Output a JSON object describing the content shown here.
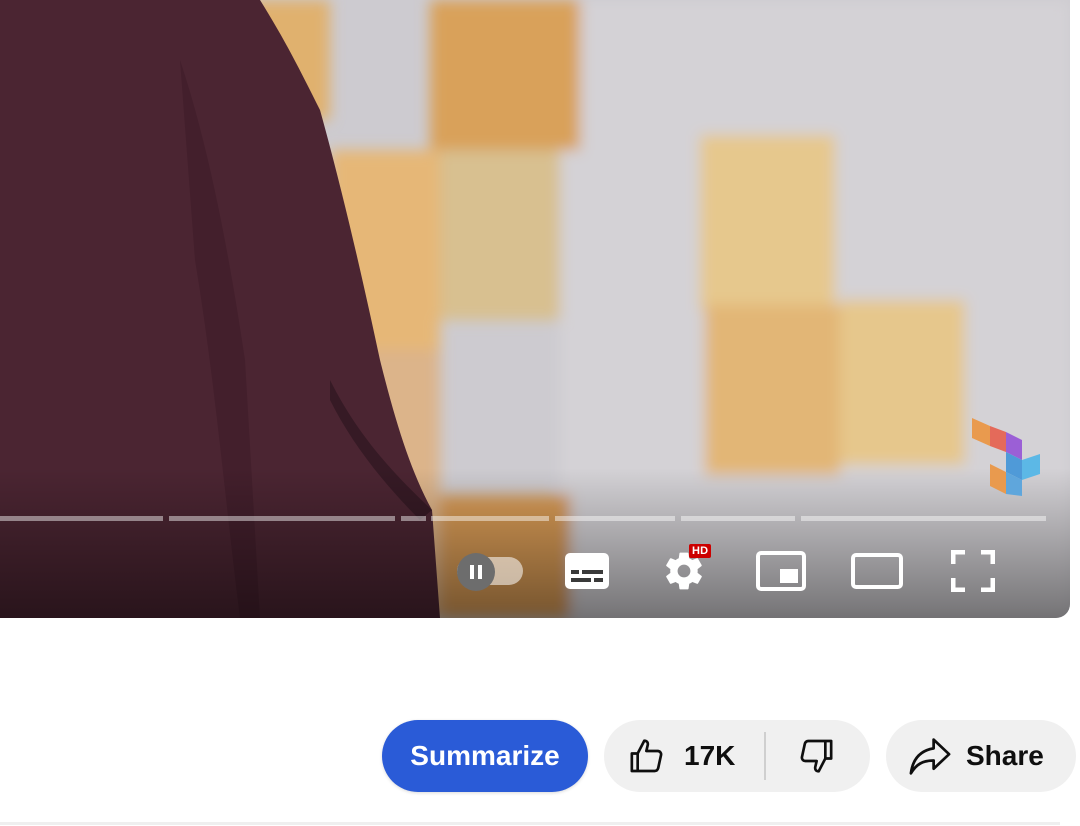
{
  "player": {
    "settings_badge": "HD",
    "icons": {
      "autoplay": "pause-icon",
      "subtitles": "subtitles-icon",
      "settings": "gear-icon",
      "miniplayer": "miniplayer-icon",
      "theater": "theater-mode-icon",
      "fullscreen": "fullscreen-icon",
      "logo": "channel-watermark-logo"
    },
    "autoplay_on": true
  },
  "actions": {
    "summarize_label": "Summarize",
    "like_count": "17K",
    "share_label": "Share",
    "icons": {
      "like": "thumbs-up-icon",
      "dislike": "thumbs-down-icon",
      "share": "share-arrow-icon"
    }
  },
  "colors": {
    "summarize_bg": "#2a5bd7",
    "pill_bg": "#f0f0f0",
    "hd_badge": "#cc0000"
  }
}
